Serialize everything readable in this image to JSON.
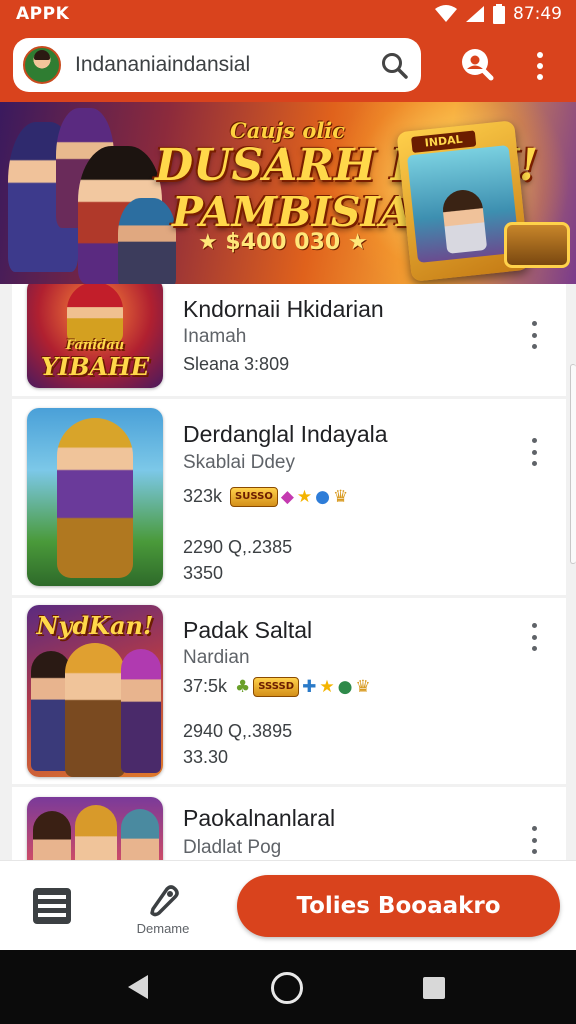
{
  "status_bar": {
    "left_text": "APPK",
    "time": "87:49",
    "icons": [
      "wifi-icon",
      "signal-icon",
      "battery-icon"
    ]
  },
  "app_bar": {
    "search_text": "Indananiaindansial",
    "icons": [
      "avatar",
      "search-icon",
      "account-search-icon",
      "more-vert-icon"
    ]
  },
  "banner": {
    "small_text": "Caujs olic",
    "title_line1": "DUSARH PIAN!",
    "title_line2": "PAMBISIAN",
    "prize": "★ $400 030 ★",
    "card_badge": "INDAL"
  },
  "list": {
    "items": [
      {
        "thumb_label": "YIBAHE",
        "thumb_small": "Fanidau",
        "title": "Kndornaii Hkidarian",
        "subtitle": "Inamah",
        "line1": "Sleana 3:809"
      },
      {
        "title": "Derdanglal Indayala",
        "subtitle": "Skablai Ddey",
        "meta_count": "323k",
        "meta_badge": "SUSSO",
        "line1": "2290 Q,.2385",
        "line2": "3350"
      },
      {
        "thumb_label": "NydKan!",
        "title": "Padak Saltal",
        "subtitle": "Nardian",
        "meta_count": "37:5k",
        "meta_badge": "SSSSD",
        "line1": "2940 Q,.3895",
        "line2": "33.30"
      },
      {
        "title": "Paokalnanlaral",
        "subtitle": "Dladlat Pog"
      }
    ]
  },
  "bottom_bar": {
    "tag_label": "Demame",
    "cta_label": "Tolies Booaakro"
  },
  "colors": {
    "accent": "#d9431d",
    "text_primary": "#202124",
    "text_secondary": "#5f6368"
  }
}
